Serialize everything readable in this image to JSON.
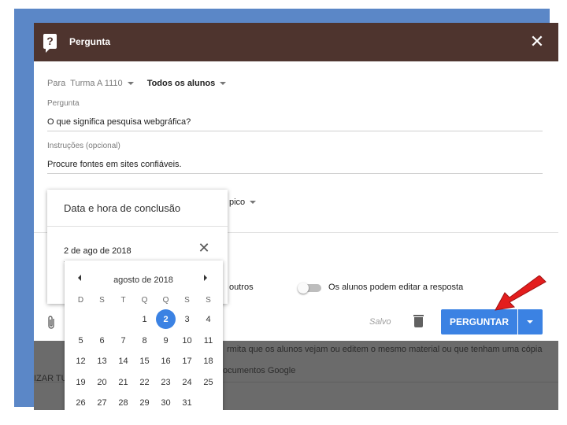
{
  "dialog": {
    "title": "Pergunta",
    "close_glyph": "✕",
    "question_glyph": "?"
  },
  "audience": {
    "prefix": "Para",
    "class": "Turma A 1110",
    "students": "Todos os alunos"
  },
  "question": {
    "label": "Pergunta",
    "value": "O que significa pesquisa webgráfica?"
  },
  "instructions": {
    "label": "Instruções (opcional)",
    "value": "Procure fontes em sites confiáveis."
  },
  "topic_partial": "pico",
  "options": {
    "others_partial": "outros",
    "toggle_label": "Os alunos podem editar a resposta",
    "toggle_on": false
  },
  "footer": {
    "attach_icon": "paperclip-icon",
    "saved": "Salvo",
    "ask_button": "PERGUNTAR"
  },
  "date_popup": {
    "title": "Data e hora de conclusão",
    "value": "2 de ago de 2018",
    "clear_glyph": "✕"
  },
  "calendar": {
    "month": "agosto de 2018",
    "weekdays": [
      "D",
      "S",
      "T",
      "Q",
      "Q",
      "S",
      "S"
    ],
    "weeks": [
      [
        "",
        "",
        "",
        "1",
        "2",
        "3",
        "4"
      ],
      [
        "5",
        "6",
        "7",
        "8",
        "9",
        "10",
        "11"
      ],
      [
        "12",
        "13",
        "14",
        "15",
        "16",
        "17",
        "18"
      ],
      [
        "19",
        "20",
        "21",
        "22",
        "23",
        "24",
        "25"
      ],
      [
        "26",
        "27",
        "28",
        "29",
        "30",
        "31",
        ""
      ]
    ],
    "selected": "2"
  },
  "background": {
    "text1": "rmita que os alunos vejam ou editem o mesmo material ou que tenham uma cópia",
    "text2": "ocumentos Google",
    "left_text": "IZAR TU"
  },
  "colors": {
    "header": "#4e342e",
    "frame": "#5b87c7",
    "accent": "#3b82e3",
    "arrow": "#e31d1d"
  }
}
